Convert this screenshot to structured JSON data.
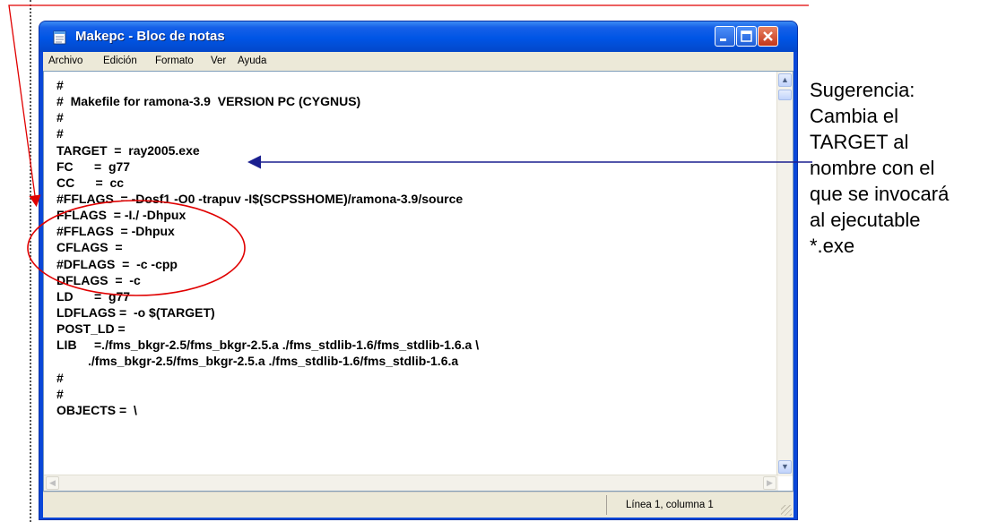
{
  "window": {
    "title": "Makepc - Bloc de notas",
    "icon": "notepad-icon",
    "controls": [
      "minimize-icon",
      "maximize-icon",
      "close-icon"
    ]
  },
  "menu": {
    "items": [
      "Archivo",
      "Edición",
      "Formato",
      "Ver",
      "Ayuda"
    ]
  },
  "editor": {
    "lines": [
      "#",
      "#  Makefile for ramona-3.9  VERSION PC (CYGNUS)",
      "#",
      "#",
      "TARGET  =  ray2005.exe",
      "FC      =  g77",
      "CC      =  cc",
      "#FFLAGS  = -Dosf1 -O0 -trapuv -I$(SCPSSHOME)/ramona-3.9/source",
      "FFLAGS  = -I./ -Dhpux",
      "#FFLAGS  = -Dhpux",
      "CFLAGS  =",
      "#DFLAGS  =  -c -cpp",
      "DFLAGS  =  -c",
      "LD      =  g77",
      "LDFLAGS =  -o $(TARGET)",
      "POST_LD =",
      "LIB     =./fms_bkgr-2.5/fms_bkgr-2.5.a ./fms_stdlib-1.6/fms_stdlib-1.6.a \\",
      "         ./fms_bkgr-2.5/fms_bkgr-2.5.a ./fms_stdlib-1.6/fms_stdlib-1.6.a",
      "#",
      "#",
      "OBJECTS =  \\"
    ]
  },
  "status": {
    "position": "Línea 1, columna 1"
  },
  "annotation": {
    "note": "Sugerencia:\nCambia el\nTARGET al\nnombre con el\nque se invocará\nal ejecutable\n*.exe",
    "arrow_color": "#1a1f8f",
    "highlight_color": "#e00000"
  },
  "colors": {
    "titlebar": "#0055e5",
    "menubar": "#ece9d8",
    "close_button": "#c3361a"
  }
}
